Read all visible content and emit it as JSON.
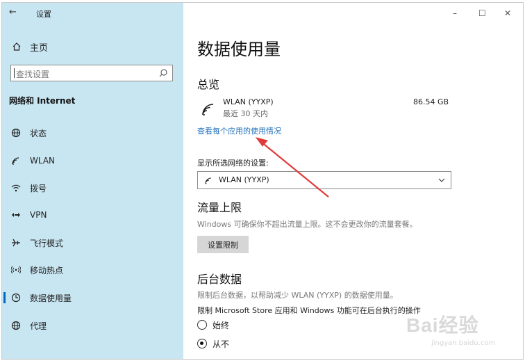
{
  "window": {
    "title": "设置",
    "back_glyph": "←",
    "controls": {
      "minimize": "–",
      "maximize": "☐",
      "close": "✕"
    }
  },
  "sidebar": {
    "home_label": "主页",
    "search_placeholder": "查找设置",
    "section_title": "网络和 Internet",
    "items": [
      {
        "label": "状态",
        "icon": "globe-status-icon"
      },
      {
        "label": "WLAN",
        "icon": "wifi-icon"
      },
      {
        "label": "拨号",
        "icon": "dialup-icon"
      },
      {
        "label": "VPN",
        "icon": "vpn-icon"
      },
      {
        "label": "飞行模式",
        "icon": "airplane-icon"
      },
      {
        "label": "移动热点",
        "icon": "hotspot-icon"
      },
      {
        "label": "数据使用量",
        "icon": "data-usage-icon",
        "active": true
      },
      {
        "label": "代理",
        "icon": "globe-proxy-icon"
      }
    ]
  },
  "main": {
    "title": "数据使用量",
    "overview": {
      "heading": "总览",
      "network_name": "WLAN (YYXP)",
      "period": "最近 30 天内",
      "usage": "86.54 GB",
      "link": "查看每个应用的使用情况"
    },
    "network_select": {
      "label": "显示所选网络的设置:",
      "value": "WLAN (YYXP)"
    },
    "limit": {
      "heading": "流量上限",
      "desc": "Windows 可确保你不超出流量上限。这不会更改你的流量套餐。",
      "button": "设置限制"
    },
    "background": {
      "heading": "后台数据",
      "desc": "限制后台数据，以帮助减少 WLAN (YYXP) 的数据使用量。",
      "question": "限制 Microsoft Store 应用和 Windows 功能可在后台执行的操作",
      "options": [
        {
          "label": "始终",
          "selected": false
        },
        {
          "label": "从不",
          "selected": true
        }
      ]
    }
  },
  "watermark": {
    "text": "Bai经验",
    "url": "jingyan.baidu.com"
  },
  "colors": {
    "sidebar_bg": "#c8e6f2",
    "accent": "#0067c0",
    "link": "#1f6fb8",
    "annotation_arrow": "#e03a3a"
  }
}
